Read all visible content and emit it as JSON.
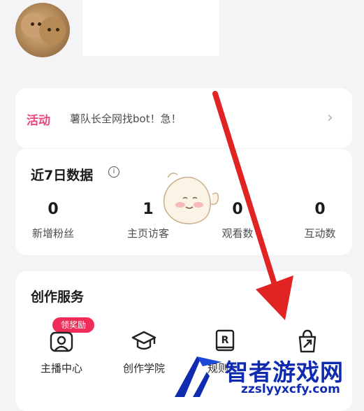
{
  "activity": {
    "tag": "活动",
    "text": "薯队长全网找bot！急！",
    "chevron": "›"
  },
  "stats": {
    "title": "近7日数据",
    "info_icon": "i",
    "items": [
      {
        "value": "0",
        "label": "新增粉丝"
      },
      {
        "value": "1",
        "label": "主页访客"
      },
      {
        "value": "0",
        "label": "观看数"
      },
      {
        "value": "0",
        "label": "互动数"
      }
    ]
  },
  "services": {
    "title": "创作服务",
    "badge": "领奖励",
    "items": [
      {
        "label": "主播中心",
        "icon": "anchor-center-icon"
      },
      {
        "label": "创作学院",
        "icon": "graduation-cap-icon"
      },
      {
        "label": "规则",
        "icon": "rules-book-icon"
      },
      {
        "label": "",
        "icon": "shopping-bag-icon"
      }
    ]
  },
  "watermark": {
    "title": "智者游戏网",
    "url": "zzslyyxcfy.com"
  },
  "colors": {
    "accent_pink": "#e9487a",
    "badge_red": "#ee2c57",
    "arrow_red": "#e02424",
    "watermark_blue": "#0f2bb0"
  }
}
